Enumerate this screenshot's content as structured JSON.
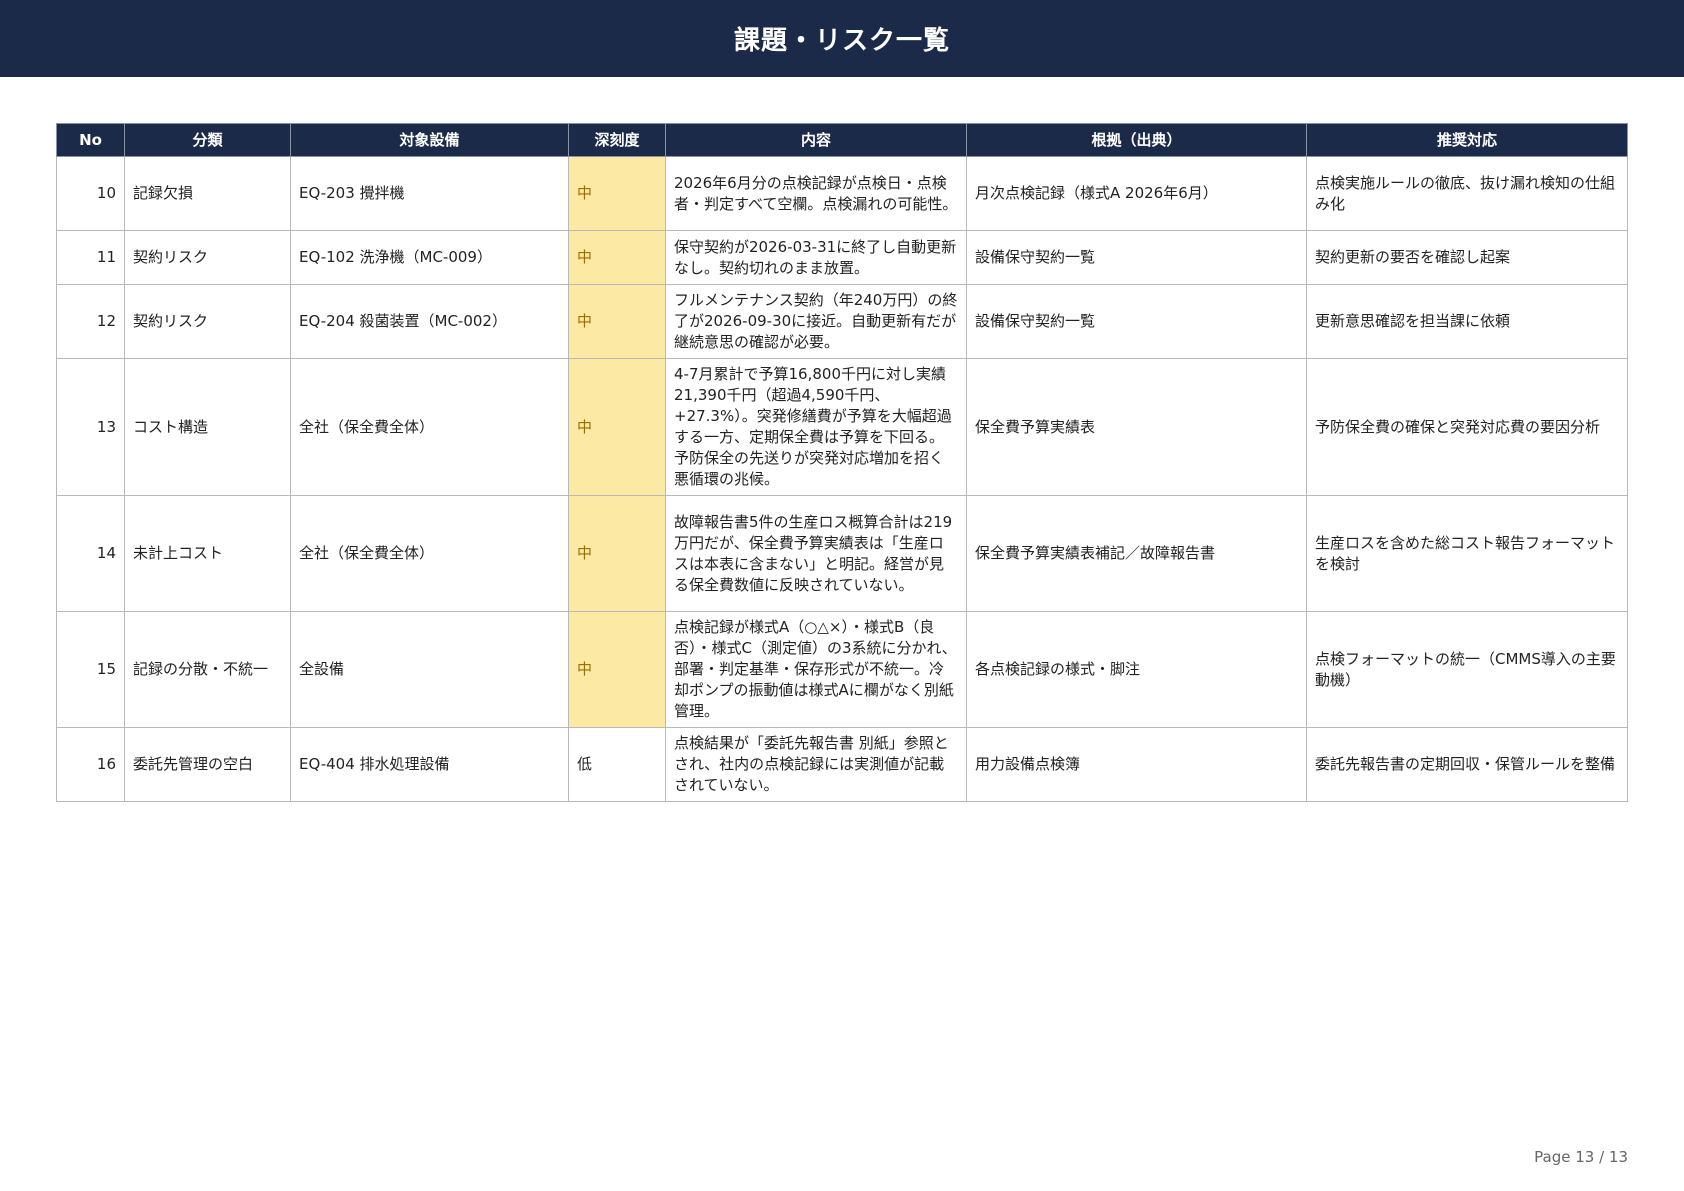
{
  "title": "課題・リスク一覧",
  "table": {
    "headers": [
      "No",
      "分類",
      "対象設備",
      "深刻度",
      "内容",
      "根拠（出典）",
      "推奨対応"
    ],
    "rows": [
      {
        "no": "10",
        "category": "記録欠損",
        "equipment": "EQ-203 攪拌機",
        "severity": "中",
        "content": "2026年6月分の点検記録が点検日・点検者・判定すべて空欄。点検漏れの可能性。",
        "source": "月次点検記録（様式A 2026年6月）",
        "action": "点検実施ルールの徹底、抜け漏れ検知の仕組み化"
      },
      {
        "no": "11",
        "category": "契約リスク",
        "equipment": "EQ-102 洗浄機（MC-009）",
        "severity": "中",
        "content": "保守契約が2026-03-31に終了し自動更新なし。契約切れのまま放置。",
        "source": "設備保守契約一覧",
        "action": "契約更新の要否を確認し起案"
      },
      {
        "no": "12",
        "category": "契約リスク",
        "equipment": "EQ-204 殺菌装置（MC-002）",
        "severity": "中",
        "content": "フルメンテナンス契約（年240万円）の終了が2026-09-30に接近。自動更新有だが継続意思の確認が必要。",
        "source": "設備保守契約一覧",
        "action": "更新意思確認を担当課に依頼"
      },
      {
        "no": "13",
        "category": "コスト構造",
        "equipment": "全社（保全費全体）",
        "severity": "中",
        "content": "4-7月累計で予算16,800千円に対し実績21,390千円（超過4,590千円、+27.3%）。突発修繕費が予算を大幅超過する一方、定期保全費は予算を下回る。予防保全の先送りが突発対応増加を招く悪循環の兆候。",
        "source": "保全費予算実績表",
        "action": "予防保全費の確保と突発対応費の要因分析"
      },
      {
        "no": "14",
        "category": "未計上コスト",
        "equipment": "全社（保全費全体）",
        "severity": "中",
        "content": "故障報告書5件の生産ロス概算合計は219万円だが、保全費予算実績表は「生産ロスは本表に含まない」と明記。経営が見る保全費数値に反映されていない。",
        "source": "保全費予算実績表補記／故障報告書",
        "action": "生産ロスを含めた総コスト報告フォーマットを検討"
      },
      {
        "no": "15",
        "category": "記録の分散・不統一",
        "equipment": "全設備",
        "severity": "中",
        "content": "点検記録が様式A（○△×）・様式B（良否）・様式C（測定値）の3系統に分かれ、部署・判定基準・保存形式が不統一。冷却ポンプの振動値は様式Aに欄がなく別紙管理。",
        "source": "各点検記録の様式・脚注",
        "action": "点検フォーマットの統一（CMMS導入の主要動機）"
      },
      {
        "no": "16",
        "category": "委託先管理の空白",
        "equipment": "EQ-404 排水処理設備",
        "severity": "低",
        "content": "点検結果が「委託先報告書 別紙」参照とされ、社内の点検記録には実測値が記載されていない。",
        "source": "用力設備点検簿",
        "action": "委託先報告書の定期回収・保管ルールを整備"
      }
    ]
  },
  "footer": {
    "page": "Page 13 / 13"
  },
  "colors": {
    "header_bg": "#1c2a4a",
    "severity_mid_bg": "#fbe9a4",
    "severity_mid_text": "#9a6d00"
  }
}
